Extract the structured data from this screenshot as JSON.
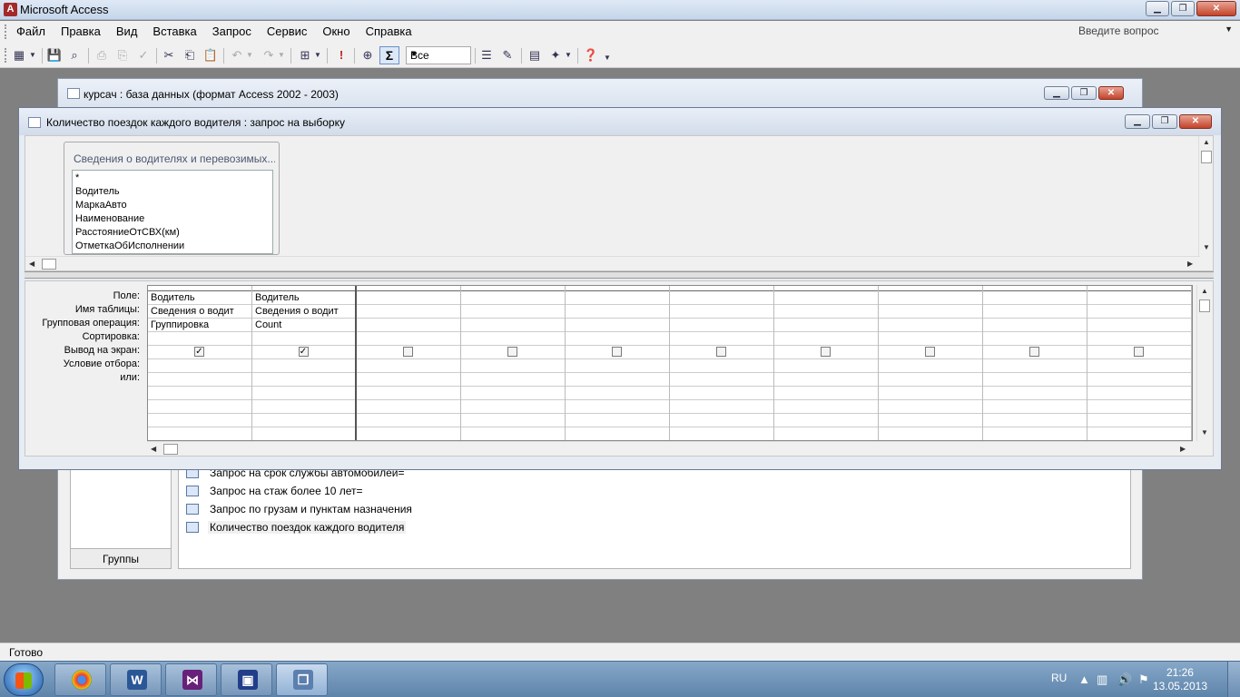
{
  "app": {
    "title": "Microsoft Access"
  },
  "menu": {
    "items": [
      "Файл",
      "Правка",
      "Вид",
      "Вставка",
      "Запрос",
      "Сервис",
      "Окно",
      "Справка"
    ],
    "ask_placeholder": "Введите вопрос"
  },
  "toolbar": {
    "combo_value": "Все",
    "icons": [
      "view-icon",
      "save-icon",
      "search-icon",
      "print-icon",
      "print-preview-icon",
      "spelling-icon",
      "cut-icon",
      "copy-icon",
      "paste-icon",
      "undo-icon",
      "redo-icon",
      "query-type-icon",
      "run-icon",
      "show-table-icon",
      "totals-icon",
      "properties-icon",
      "build-icon",
      "database-window-icon",
      "new-object-icon",
      "help-icon"
    ]
  },
  "db_window": {
    "title": "курсач : база данных (формат Access 2002 - 2003)",
    "groups_label": "Группы",
    "queries": [
      "Запрос на срок службы автомобилей=",
      "Запрос на стаж более 10 лет=",
      "Запрос по грузам и пунктам назначения",
      "Количество поездок каждого водителя"
    ]
  },
  "query_window": {
    "title": "Количество поездок каждого водителя : запрос на выборку",
    "field_list": {
      "header": "Сведения о водителях и перевозимых...",
      "fields": [
        "*",
        "Водитель",
        "МаркаАвто",
        "Наименование",
        "РасстояниеОтСВХ(км)",
        "ОтметкаОбИсполнении"
      ]
    },
    "row_labels": [
      "Поле:",
      "Имя таблицы:",
      "Групповая операция:",
      "Сортировка:",
      "Вывод на экран:",
      "Условие отбора:",
      "или:"
    ],
    "columns": [
      {
        "field": "Водитель",
        "table": "Сведения о водит",
        "total": "Группировка",
        "sort": "",
        "show": true
      },
      {
        "field": "Водитель",
        "table": "Сведения о водит",
        "total": "Count",
        "sort": "",
        "show": true
      },
      {
        "field": "",
        "table": "",
        "total": "",
        "sort": "",
        "show": false
      },
      {
        "field": "",
        "table": "",
        "total": "",
        "sort": "",
        "show": false
      },
      {
        "field": "",
        "table": "",
        "total": "",
        "sort": "",
        "show": false
      },
      {
        "field": "",
        "table": "",
        "total": "",
        "sort": "",
        "show": false
      },
      {
        "field": "",
        "table": "",
        "total": "",
        "sort": "",
        "show": false
      },
      {
        "field": "",
        "table": "",
        "total": "",
        "sort": "",
        "show": false
      },
      {
        "field": "",
        "table": "",
        "total": "",
        "sort": "",
        "show": false
      },
      {
        "field": "",
        "table": "",
        "total": "",
        "sort": "",
        "show": false
      }
    ]
  },
  "status": {
    "text": "Готово"
  },
  "taskbar": {
    "apps": [
      "chrome-icon",
      "word-icon",
      "visual-studio-icon",
      "save-disk-icon",
      "access-windows-icon"
    ],
    "lang": "RU",
    "time": "21:26",
    "date": "13.05.2013"
  }
}
